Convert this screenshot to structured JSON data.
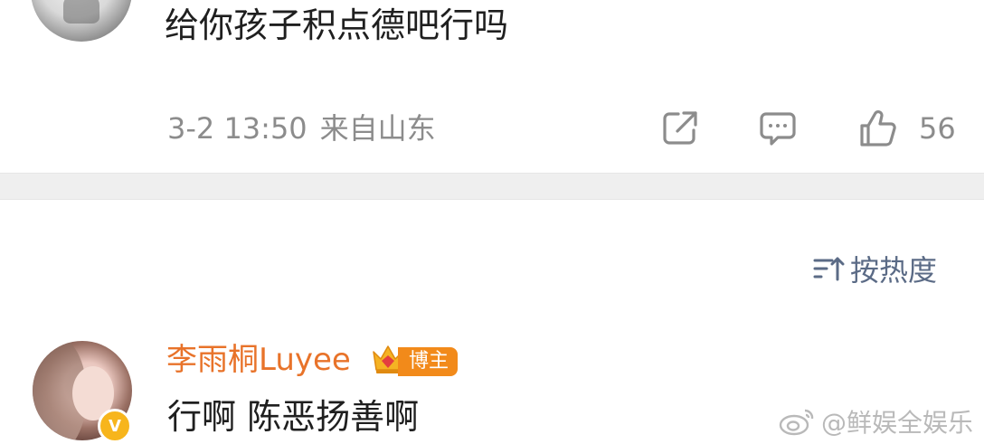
{
  "top_post": {
    "text": "给你孩子积点德吧行吗",
    "date": "3-2 13:50",
    "location": "来自山东",
    "like_count": "56",
    "icons": {
      "share": "share-icon",
      "comment": "comment-icon",
      "like": "thumbs-up-icon"
    }
  },
  "sort": {
    "label": "按热度",
    "icon": "sort-icon"
  },
  "comment": {
    "author": "李雨桐Luyee",
    "author_tag": "博主",
    "text": "行啊 陈恶扬善啊",
    "badges": {
      "verified": "v-badge-icon",
      "crown": "crown-icon"
    },
    "verified_letter": "V"
  },
  "watermark": {
    "text": "@鲜娱全娱乐",
    "icon": "weibo-logo-icon"
  },
  "colors": {
    "author_name": "#e8732a",
    "author_tag_bg": "#f28a1a",
    "sort_text": "#5b6b86",
    "meta_gray": "#8c8c8c",
    "divider_bg": "#efefef",
    "verified_badge": "#f7b51c"
  }
}
